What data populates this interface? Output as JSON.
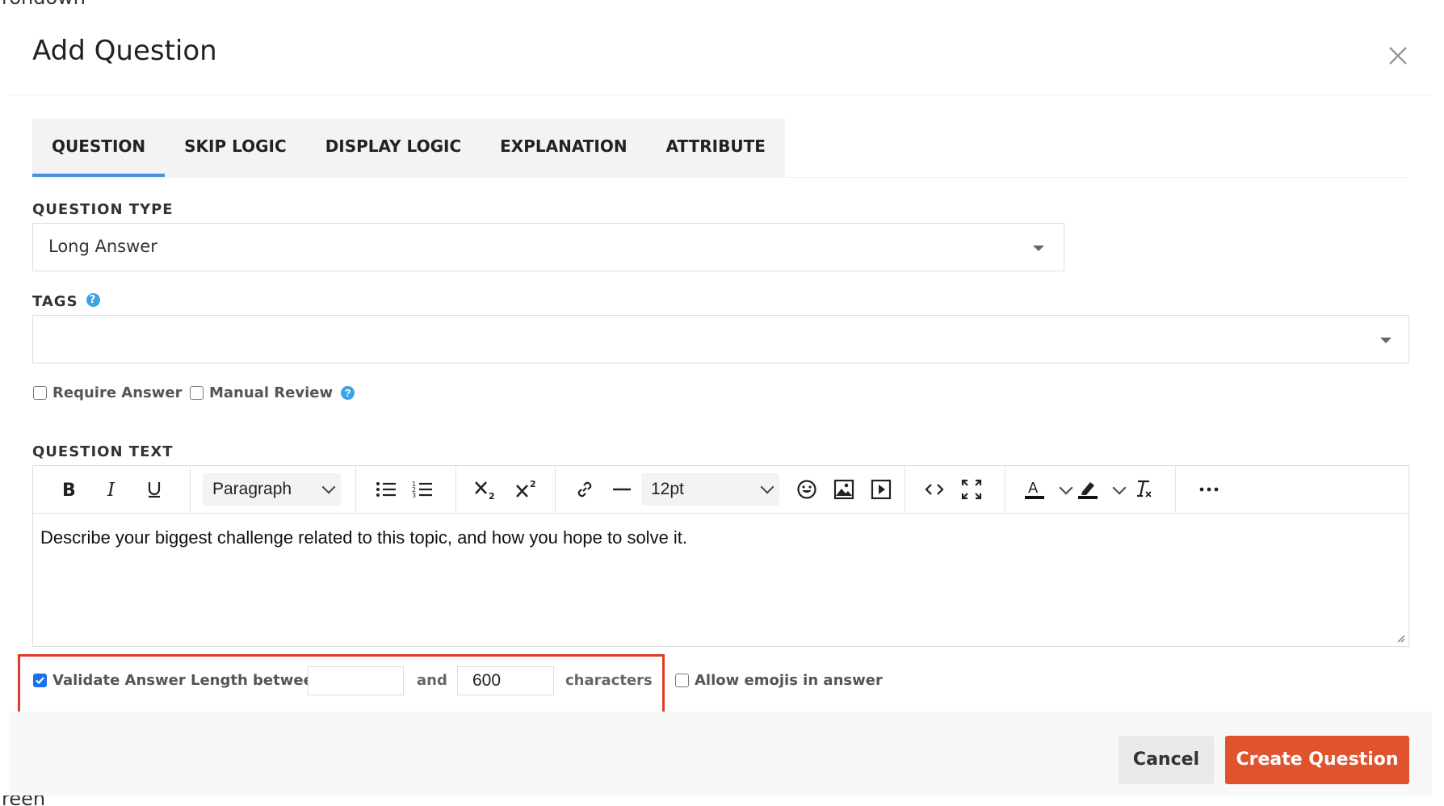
{
  "background": {
    "top_fragment": "rondown",
    "bottom_fragment": "reen"
  },
  "modal": {
    "title": "Add Question",
    "close_icon": "close-icon"
  },
  "tabs": [
    {
      "label": "QUESTION",
      "active": true
    },
    {
      "label": "SKIP LOGIC",
      "active": false
    },
    {
      "label": "DISPLAY LOGIC",
      "active": false
    },
    {
      "label": "EXPLANATION",
      "active": false
    },
    {
      "label": "ATTRIBUTE",
      "active": false
    }
  ],
  "question_type": {
    "label": "QUESTION TYPE",
    "value": "Long Answer"
  },
  "tags": {
    "label": "TAGS",
    "value": ""
  },
  "options": {
    "require_answer": {
      "label": "Require Answer",
      "checked": false
    },
    "manual_review": {
      "label": "Manual Review",
      "checked": false
    }
  },
  "question_text": {
    "label": "QUESTION TEXT",
    "block_format": "Paragraph",
    "font_size": "12pt",
    "content": "Describe your biggest challenge related to this topic, and how you hope to solve it.",
    "toolbar_icons": [
      "bold-icon",
      "italic-icon",
      "underline-icon",
      "bulleted-list-icon",
      "numbered-list-icon",
      "subscript-icon",
      "superscript-icon",
      "link-icon",
      "horizontal-rule-icon",
      "emoji-icon",
      "image-icon",
      "video-icon",
      "source-code-icon",
      "fullscreen-icon",
      "text-color-icon",
      "highlight-color-icon",
      "clear-formatting-icon",
      "more-icon"
    ]
  },
  "validation": {
    "label": "Validate Answer Length between",
    "checked": true,
    "min_value": "",
    "and_label": "and",
    "max_value": "600",
    "unit_label": "characters",
    "highlight_color": "#e03b24"
  },
  "emojis": {
    "label": "Allow emojis in answer",
    "checked": false
  },
  "footer": {
    "cancel_label": "Cancel",
    "create_label": "Create Question",
    "create_color": "#e0532f"
  },
  "accent_color": "#4a90e2"
}
